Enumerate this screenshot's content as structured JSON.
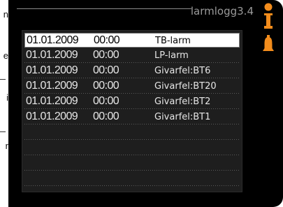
{
  "side_text": [
    "n",
    "e",
    "i",
    "r"
  ],
  "header": {
    "title": "larmlogg3.4"
  },
  "icons": {
    "top": "info-icon",
    "bottom": "bell-icon"
  },
  "colors": {
    "accent": "#f28c1c",
    "screen_bg": "#000000",
    "panel_bg": "#1e1e1e"
  },
  "alarm_log": {
    "rows": [
      {
        "date": "01.01.2009",
        "time": "00:00",
        "type": "TB-larm",
        "selected": true
      },
      {
        "date": "01.01.2009",
        "time": "00:00",
        "type": "LP-larm",
        "selected": false
      },
      {
        "date": "01.01.2009",
        "time": "00:00",
        "type": "Givarfel:BT6",
        "selected": false
      },
      {
        "date": "01.01.2009",
        "time": "00:00",
        "type": "Givarfel:BT20",
        "selected": false
      },
      {
        "date": "01.01.2009",
        "time": "00:00",
        "type": "Givarfel:BT2",
        "selected": false
      },
      {
        "date": "01.01.2009",
        "time": "00:00",
        "type": "Givarfel:BT1",
        "selected": false
      },
      {
        "date": "",
        "time": "",
        "type": "",
        "selected": false
      },
      {
        "date": "",
        "time": "",
        "type": "",
        "selected": false
      },
      {
        "date": "",
        "time": "",
        "type": "",
        "selected": false
      },
      {
        "date": "",
        "time": "",
        "type": "",
        "selected": false
      }
    ]
  }
}
